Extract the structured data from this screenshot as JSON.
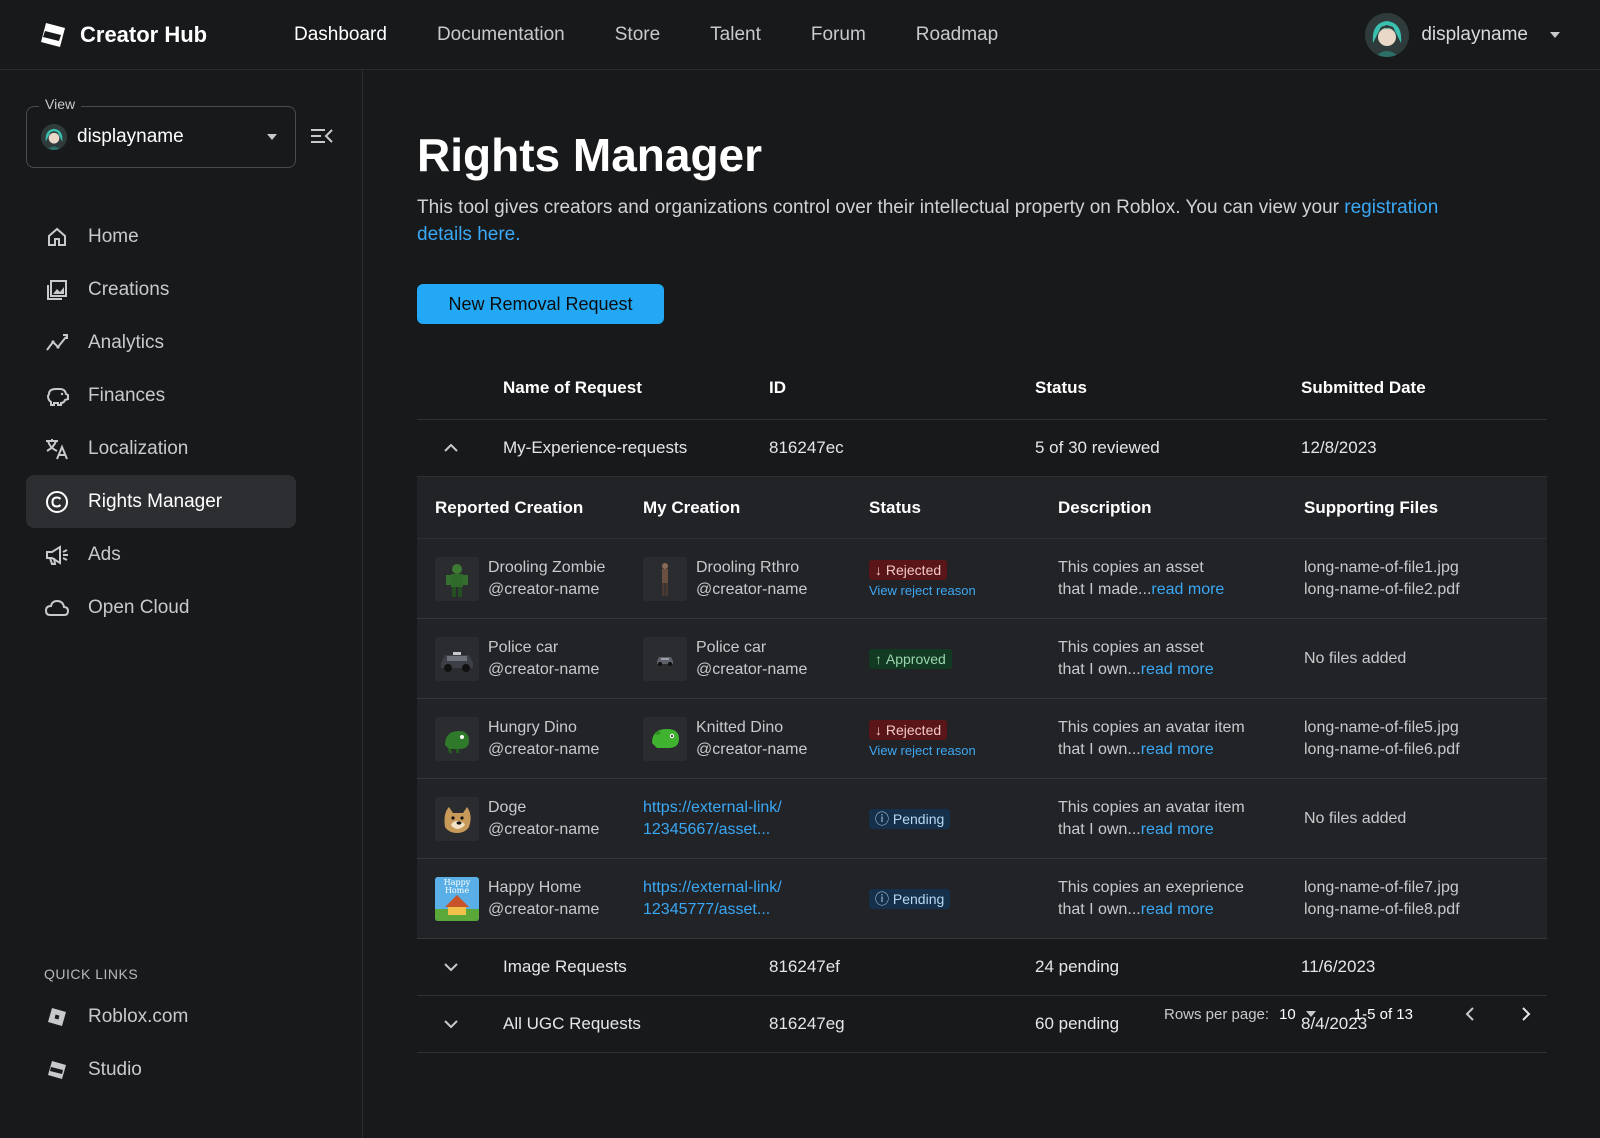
{
  "header": {
    "brand": "Creator Hub",
    "nav": [
      "Dashboard",
      "Documentation",
      "Store",
      "Talent",
      "Forum",
      "Roadmap"
    ],
    "username": "displayname"
  },
  "sidebar": {
    "view_label": "View",
    "view_value": "displayname",
    "items": [
      {
        "label": "Home",
        "icon": "home-icon"
      },
      {
        "label": "Creations",
        "icon": "creations-icon"
      },
      {
        "label": "Analytics",
        "icon": "analytics-icon"
      },
      {
        "label": "Finances",
        "icon": "piggy-bank-icon"
      },
      {
        "label": "Localization",
        "icon": "translate-icon"
      },
      {
        "label": "Rights Manager",
        "icon": "copyright-icon"
      },
      {
        "label": "Ads",
        "icon": "megaphone-icon"
      },
      {
        "label": "Open Cloud",
        "icon": "cloud-icon"
      }
    ],
    "quick_links_title": "QUICK LINKS",
    "quick_links": [
      {
        "label": "Roblox.com",
        "icon": "roblox-icon"
      },
      {
        "label": "Studio",
        "icon": "studio-icon"
      }
    ]
  },
  "main": {
    "title": "Rights Manager",
    "intro": "This tool gives creators and organizations control over their intellectual property on Roblox. You can view your ",
    "intro_link": "registration details here.",
    "new_request_button": "New Removal Request",
    "table": {
      "columns": [
        "Name of Request",
        "ID",
        "Status",
        "Submitted Date"
      ],
      "rows": [
        {
          "name": "My-Experience-requests",
          "id": "816247ec",
          "status": "5 of 30 reviewed",
          "date": "12/8/2023"
        },
        {
          "name": "Image Requests",
          "id": "816247ef",
          "status": "24 pending",
          "date": "11/6/2023"
        },
        {
          "name": "All UGC Requests",
          "id": "816247eg",
          "status": "60 pending",
          "date": "8/4/2023"
        }
      ]
    },
    "subtable": {
      "columns": [
        "Reported Creation",
        "My Creation",
        "Status",
        "Description",
        "Supporting Files"
      ],
      "rows": [
        {
          "reported_name": "Drooling Zombie",
          "reported_creator": "@creator-name",
          "my_name": "Drooling Rthro",
          "my_creator": "@creator-name",
          "status": "Rejected",
          "status_link": "View reject reason",
          "desc_line1": "This copies an asset",
          "desc_line2": "that I made...",
          "read_more": "read more",
          "file1": "long-name-of-file1.jpg",
          "file2": "long-name-of-file2.pdf"
        },
        {
          "reported_name": "Police car",
          "reported_creator": "@creator-name",
          "my_name": "Police car",
          "my_creator": "@creator-name",
          "status": "Approved",
          "desc_line1": "This copies an asset",
          "desc_line2": "that I own...",
          "read_more": "read more",
          "files_none": "No files added"
        },
        {
          "reported_name": "Hungry Dino",
          "reported_creator": "@creator-name",
          "my_name": "Knitted Dino",
          "my_creator": "@creator-name",
          "status": "Rejected",
          "status_link": "View reject reason",
          "desc_line1": "This copies an avatar item",
          "desc_line2": "that I own...",
          "read_more": "read more",
          "file1": "long-name-of-file5.jpg",
          "file2": "long-name-of-file6.pdf"
        },
        {
          "reported_name": "Doge",
          "reported_creator": "@creator-name",
          "my_link1": "https://external-link/",
          "my_link2": "12345667/asset...",
          "status": "Pending",
          "desc_line1": "This copies an avatar item",
          "desc_line2": "that I own...",
          "read_more": "read more",
          "files_none": "No files added"
        },
        {
          "reported_name": "Happy Home",
          "reported_creator": "@creator-name",
          "thumb_text": "Happy Home",
          "my_link1": "https://external-link/",
          "my_link2": "12345777/asset...",
          "status": "Pending",
          "desc_line1": "This copies an exeprience",
          "desc_line2": "that I own...",
          "read_more": "read more",
          "file1": "long-name-of-file7.jpg",
          "file2": "long-name-of-file8.pdf"
        }
      ]
    },
    "pagination": {
      "rows_per_page_label": "Rows per page:",
      "rows_per_page": "10",
      "range": "1-5 of 13"
    }
  },
  "colors": {
    "background": "#18191b",
    "accent": "#22a8f5",
    "link": "#3aa8f5",
    "rejected": "#5a1518",
    "approved": "#123a22",
    "pending": "#14304a"
  }
}
